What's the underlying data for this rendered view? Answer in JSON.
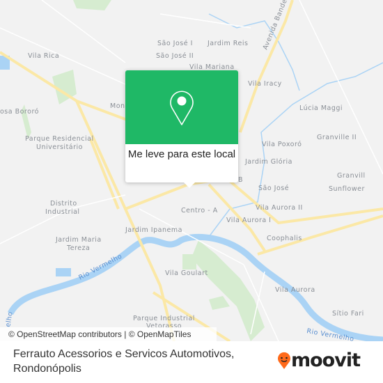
{
  "map": {
    "labels": [
      "Vila Rica",
      "São José I",
      "Jardim Reis",
      "São José II",
      "Vila Mariana",
      "Vila Iracy",
      "Mon",
      "Lúcia Maggi",
      "osa Bororó",
      "Parque Residencial",
      "Universitário",
      "Granville II",
      "Vila Poxoró",
      "Jardim Glória",
      "Granvill",
      "São José",
      "Sunflower",
      "B",
      "Distrito",
      "Industrial",
      "Centro - A",
      "Vila Aurora II",
      "Vila Aurora I",
      "Jardim Ipanema",
      "Coophalis",
      "Jardim Maria",
      "Tereza",
      "Vila Goulart",
      "Vila Aurora",
      "Sítio Fari",
      "Parque Industrial",
      "Vetorasso"
    ],
    "street_label": "Avenida Bandei",
    "river_labels": [
      "Rio Vermelho",
      "Rio Vermelho",
      "elho"
    ],
    "colors": {
      "road": "#fbe8a6",
      "river": "#aad3f5",
      "park": "#d6ecd0",
      "background": "#f2f2f2"
    }
  },
  "popup": {
    "icon": "map-pin-icon",
    "label": "Me leve para este local",
    "color": "#1fb866"
  },
  "attribution": "© OpenStreetMap contributors | © OpenMapTiles",
  "footer": {
    "place_line1": "Ferrauto Acessorios e Servicos Automotivos,",
    "place_line2": "Rondonópolis",
    "logo": "moovit",
    "logo_color": "#ff6a1a"
  }
}
